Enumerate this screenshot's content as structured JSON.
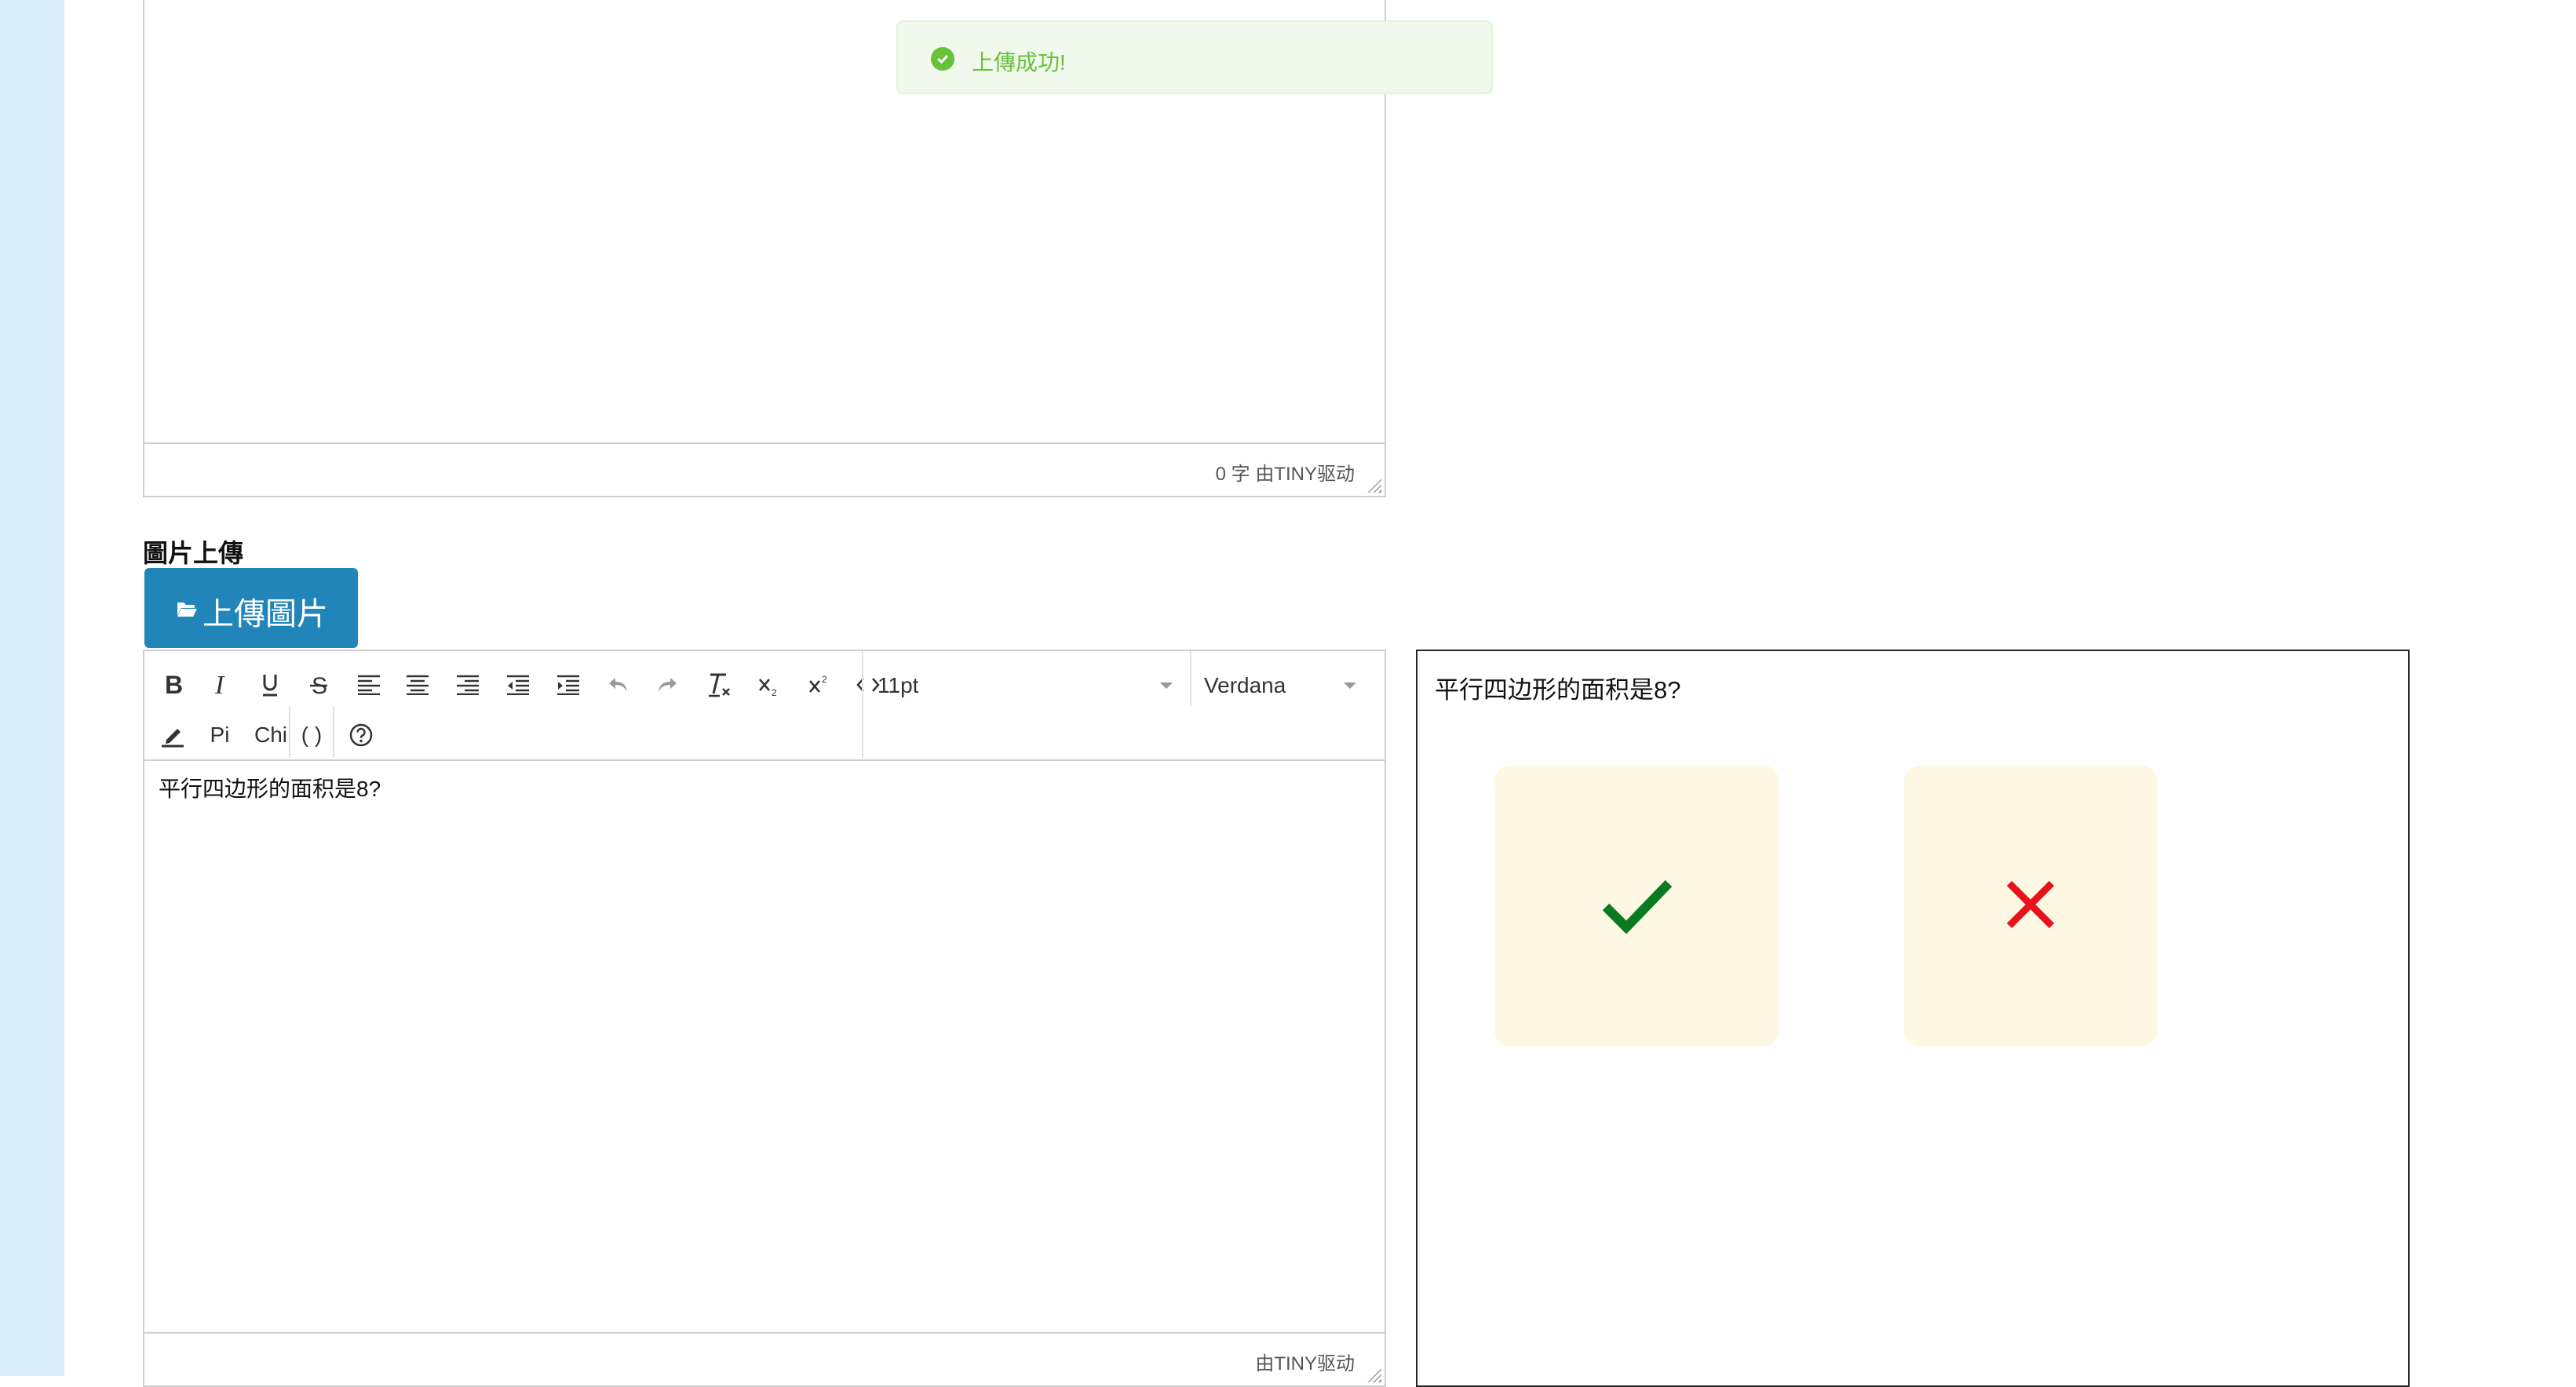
{
  "toast": {
    "message": "上傳成功!",
    "color": "#67c23a"
  },
  "top_editor": {
    "status": "0 字 由TINY驱动"
  },
  "image_upload": {
    "section_label": "圖片上傳",
    "button_label": "上傳圖片",
    "button_color": "#2185b9"
  },
  "editor": {
    "toolbar": {
      "font_size": "11pt",
      "font_family": "Verdana",
      "special_buttons": {
        "pi": "Pi",
        "chi": "Chi",
        "parentheses": "( )"
      }
    },
    "content": "平行四边形的面积是8?",
    "status": "由TINY驱动"
  },
  "preview": {
    "question": "平行四边形的面积是8?",
    "answers": [
      {
        "icon": "check-icon",
        "color": "#0a7a1f"
      },
      {
        "icon": "cross-icon",
        "color": "#e8121d"
      }
    ],
    "answer_bg": "#fdf7e3"
  }
}
